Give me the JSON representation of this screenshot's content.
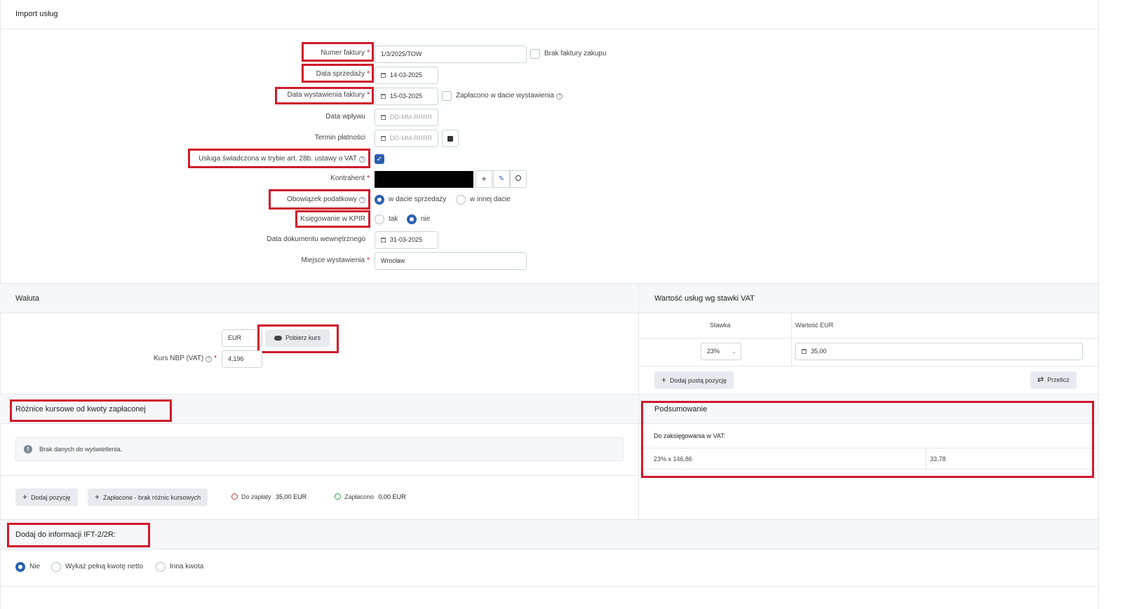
{
  "page_title": "Import usług",
  "form": {
    "invoice_number": {
      "label": "Numer faktury",
      "value": "1/3/2025/TOW",
      "no_invoice_label": "Brak faktury zakupu"
    },
    "sale_date": {
      "label": "Data sprzedaży",
      "value": "14-03-2025"
    },
    "issue_date": {
      "label": "Data wystawienia faktury",
      "value": "15-03-2025",
      "paid_label": "Zapłacono w dacie wystawienia"
    },
    "receipt_date": {
      "label": "Data wpływu",
      "placeholder": "DD-MM-RRRR"
    },
    "payment_term": {
      "label": "Termin płatności",
      "placeholder": "DD-MM-RRRR"
    },
    "art28b": {
      "label": "Usługa świadczona w trybie art. 28b. ustawy o VAT",
      "checked": true
    },
    "contractor": {
      "label": "Kontrahent"
    },
    "tax_obligation": {
      "label": "Obowiązek podatkowy",
      "options": [
        "w dacie sprzedaży",
        "w innej dacie"
      ],
      "selected": "w dacie sprzedaży"
    },
    "kpir": {
      "label": "Księgowanie w KPIR",
      "options": [
        "tak",
        "nie"
      ],
      "selected": "nie"
    },
    "internal_doc_date": {
      "label": "Data dokumentu wewnętrznego",
      "value": "31-03-2025"
    },
    "issue_place": {
      "label": "Miejsce wystawienia",
      "value": "Wrocław"
    }
  },
  "currency": {
    "title": "Waluta",
    "code": "EUR",
    "fetch_rate_label": "Pobierz kurs",
    "rate_label": "Kurs NBP (VAT)",
    "rate_value": "4,196"
  },
  "vat_values": {
    "title": "Wartość usług wg stawki VAT",
    "col_rate": "Stawka",
    "col_value": "Wartość EUR",
    "rows": [
      {
        "rate": "23%",
        "value": "35,00"
      }
    ],
    "add_empty_label": "Dodaj pustą pozycję",
    "recalc_label": "Przelicz"
  },
  "fx_diff": {
    "title": "Różnice kursowe od kwoty zapłaconej",
    "empty_msg": "Brak danych do wyświetlenia.",
    "add_label": "Dodaj pozycję",
    "paid_no_diff_label": "Zapłacone - brak różnic kursowych",
    "to_pay_label": "Do zapłaty",
    "to_pay_value": "35,00 EUR",
    "paid_label": "Zapłacono",
    "paid_value": "0,00 EUR"
  },
  "summary": {
    "title": "Podsumowanie",
    "subtitle": "Do zaksięgowania w VAT:",
    "row_desc": "23% x 146,86",
    "row_value": "33,78"
  },
  "ift": {
    "title": "Dodaj do informacji IFT-2/2R:",
    "options": [
      "Nie",
      "Wykaż pełną kwotę netto",
      "Inna kwota"
    ],
    "selected": "Nie"
  },
  "colors": {
    "accent": "#2a5fb0",
    "annotation": "#d0192b",
    "required": "#d0021b"
  }
}
